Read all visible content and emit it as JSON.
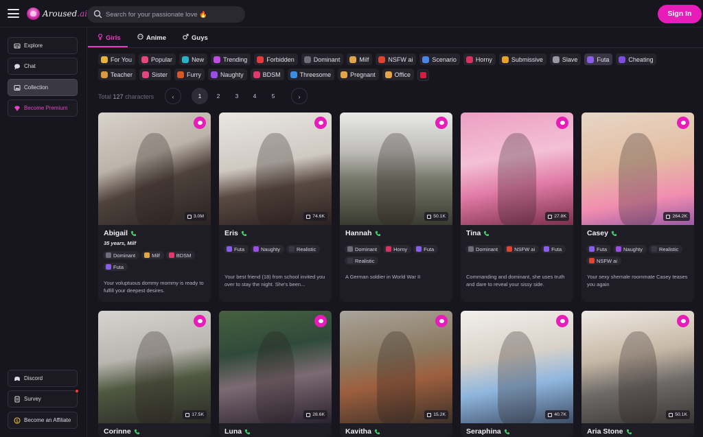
{
  "app": {
    "logo_name": "Aroused",
    "logo_suffix": ".ai"
  },
  "search": {
    "placeholder": "Search for your passionate love 🔥"
  },
  "header": {
    "signin_label": "Sign In"
  },
  "sidebar": {
    "items": [
      {
        "label": "Explore",
        "icon": "compass-icon"
      },
      {
        "label": "Chat",
        "icon": "chat-icon"
      },
      {
        "label": "Collection",
        "icon": "collection-icon"
      },
      {
        "label": "Become Premium",
        "icon": "diamond-icon"
      }
    ],
    "bottom_items": [
      {
        "label": "Discord",
        "icon": "discord-icon"
      },
      {
        "label": "Survey",
        "icon": "survey-icon"
      },
      {
        "label": "Become an Affiliate",
        "icon": "dollar-icon"
      }
    ]
  },
  "tabs": [
    {
      "label": "Girls",
      "icon": "female-icon",
      "active": true
    },
    {
      "label": "Anime",
      "icon": "anime-icon",
      "active": false
    },
    {
      "label": "Guys",
      "icon": "male-icon",
      "active": false
    }
  ],
  "categories": {
    "row1": [
      "For You",
      "Popular",
      "New",
      "Trending",
      "Forbidden",
      "Dominant",
      "Milf",
      "NSFW ai",
      "Scenario",
      "Horny",
      "Submissive",
      "Slave",
      "Futa",
      "Cheating"
    ],
    "row2": [
      "Teacher",
      "Sister",
      "Furry",
      "Naughty",
      "BDSM",
      "Threesome",
      "Pregnant",
      "Office"
    ],
    "selected": "Futa"
  },
  "listing": {
    "total_prefix": "Total",
    "total_count": "127",
    "total_suffix": "characters"
  },
  "pagination": {
    "pages": [
      "1",
      "2",
      "3",
      "4",
      "5"
    ],
    "current": "1",
    "prev": "‹",
    "next": "›"
  },
  "characters": [
    {
      "name": "Abigail",
      "meta": "35 years, Milf",
      "count": "3.0M",
      "tags": [
        "Dominant",
        "Milf",
        "BDSM",
        "Futa"
      ],
      "description": "Your voluptuous dommy mommy is ready to fulfill your deepest desires."
    },
    {
      "name": "Eris",
      "meta": "",
      "count": "74.6K",
      "tags": [
        "Futa",
        "Naughty",
        "Realistic"
      ],
      "description": "Your best friend (18) from school invited you over to stay the night. She's been..."
    },
    {
      "name": "Hannah",
      "meta": "",
      "count": "50.1K",
      "tags": [
        "Dominant",
        "Horny",
        "Futa",
        "Realistic"
      ],
      "description": "A German soldier in World War II"
    },
    {
      "name": "Tina",
      "meta": "",
      "count": "27.8K",
      "tags": [
        "Dominant",
        "NSFW ai",
        "Futa"
      ],
      "description": "Commanding and dominant, she uses truth and dare to reveal your sissy side."
    },
    {
      "name": "Casey",
      "meta": "",
      "count": "264.2K",
      "tags": [
        "Futa",
        "Naughty",
        "Realistic",
        "NSFW ai"
      ],
      "description": "Your sexy shemale roommate Casey teases you again"
    },
    {
      "name": "Corinne",
      "meta": "",
      "count": "17.5K",
      "tags": [],
      "description": ""
    },
    {
      "name": "Luna",
      "meta": "",
      "count": "28.6K",
      "tags": [],
      "description": ""
    },
    {
      "name": "Kavitha",
      "meta": "",
      "count": "15.2K",
      "tags": [],
      "description": ""
    },
    {
      "name": "Seraphina",
      "meta": "",
      "count": "40.7K",
      "tags": [],
      "description": ""
    },
    {
      "name": "Aria Stone",
      "meta": "",
      "count": "50.1K",
      "tags": [],
      "description": ""
    }
  ],
  "colors": {
    "accent": "#e81cb8",
    "background": "#17151d",
    "card": "#1e1c24",
    "chip": "#25232c"
  }
}
